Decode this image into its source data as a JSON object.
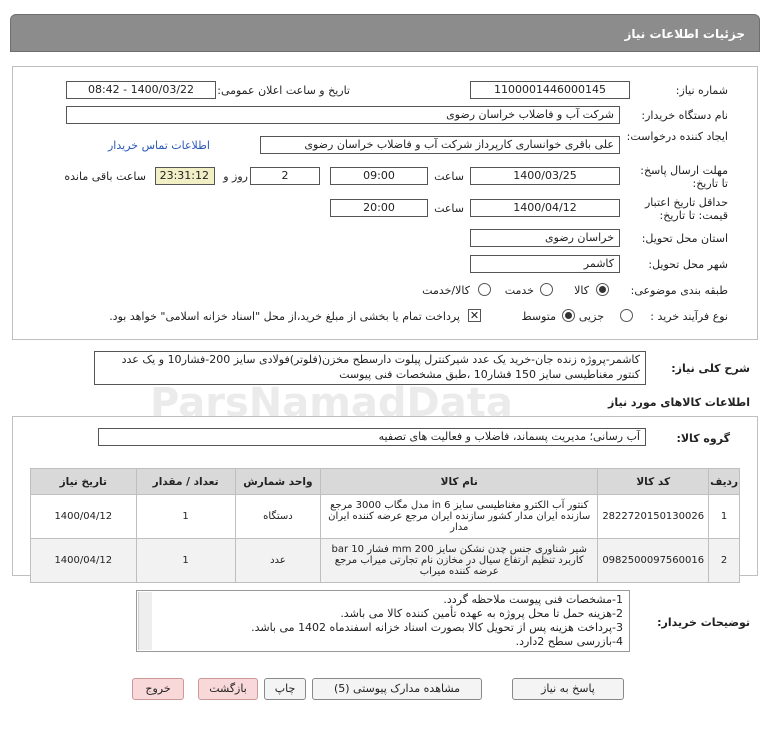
{
  "header": {
    "title": "جزئیات اطلاعات نیاز"
  },
  "fields": {
    "need_number_label": "شماره نیاز:",
    "need_number": "1100001446000145",
    "announce_label": "تاریخ و ساعت اعلان عمومی:",
    "announce_value": "1400/03/22 - 08:42",
    "buyer_label": "نام دستگاه خریدار:",
    "buyer": "شرکت آب و فاضلاب خراسان رضوی",
    "creator_label": "ایجاد کننده درخواست:",
    "creator": "علی باقری خوانساری کارپرداز شرکت آب و فاضلاب خراسان رضوی",
    "contact_link": "اطلاعات تماس خریدار",
    "reply_deadline_label": "مهلت ارسال پاسخ: تا تاریخ:",
    "reply_date": "1400/03/25",
    "time_label": "ساعت",
    "reply_time": "09:00",
    "days": "2",
    "days_label": "روز و",
    "remaining_time": "23:31:12",
    "remaining_label": "ساعت باقی مانده",
    "price_validity_label": "حداقل تاریخ اعتبار قیمت: تا تاریخ:",
    "price_date": "1400/04/12",
    "price_time": "20:00",
    "province_label": "استان محل تحویل:",
    "province": "خراسان رضوی",
    "city_label": "شهر محل تحویل:",
    "city": "کاشمر",
    "category_label": "طبقه بندی موضوعی:",
    "category_options": [
      "کالا",
      "خدمت",
      "کالا/خدمت"
    ],
    "purchase_type_label": "نوع فرآیند خرید :",
    "purchase_options": [
      "جزیی",
      "متوسط"
    ],
    "payment_note": "پرداخت تمام یا بخشی از مبلغ خرید،از محل \"اسناد خزانه اسلامی\" خواهد بود."
  },
  "description": {
    "label": "شرح کلی نیاز:",
    "text": "کاشمر-پروژه زنده جان-خرید یک عدد شیرکنترل پیلوت دارسطح مخزن(فلوتر)فولادی سایز 200-فشار10 و یک عدد کنتور مغناطیسی سایز 150 فشار10 ،طبق مشخصات فنی پیوست"
  },
  "goods": {
    "section_title": "اطلاعات کالاهای مورد نیاز",
    "group_label": "گروه کالا:",
    "group": "آب رسانی؛ مدیریت پسماند، فاضلاب و فعالیت های تصفیه",
    "columns": [
      "ردیف",
      "کد کالا",
      "نام کالا",
      "واحد شمارش",
      "تعداد / مقدار",
      "تاریخ نیاز"
    ],
    "rows": [
      {
        "idx": "1",
        "code": "2822720150130026",
        "name": "کنتور آب الکترو مغناطیسی سایز in 6 مدل مگاب 3000 مرجع سازنده ایران مدار کشور سازنده ایران مرجع عرضه کننده ایران مدار",
        "unit": "دستگاه",
        "qty": "1",
        "date": "1400/04/12"
      },
      {
        "idx": "2",
        "code": "0982500097560016",
        "name": "شیر شناوری جنس چدن نشکن سایز mm 200 فشار bar 10 کاربرد تنظیم ارتفاع سیال در مخازن نام تجارتی میراب مرجع عرضه کننده میراب",
        "unit": "عدد",
        "qty": "1",
        "date": "1400/04/12"
      }
    ]
  },
  "buyer_notes": {
    "label": "توضیحات خریدار:",
    "lines": [
      "1-مشخصات فنی پیوست ملاحظه گردد.",
      "2-هزینه حمل تا محل پروژه به عهده تأمین کننده کالا می باشد.",
      "3-پرداخت هزینه پس از تحویل کالا بصورت اسناد خزانه اسفندماه 1402 می باشد.",
      "4-بازرسی سطح 2دارد."
    ]
  },
  "buttons": {
    "reply": "پاسخ به نیاز",
    "attachments": "مشاهده مدارک پیوستی (5)",
    "print": "چاپ",
    "back": "بازگشت",
    "exit": "خروج"
  }
}
